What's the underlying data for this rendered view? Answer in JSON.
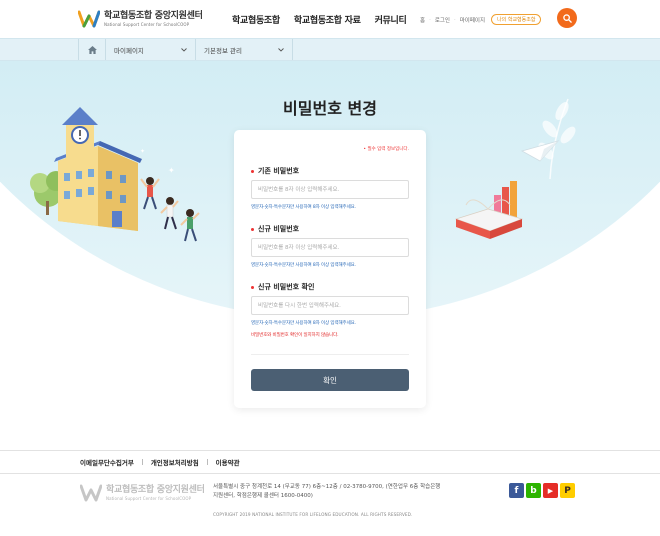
{
  "header": {
    "logo_title": "학교협동조합 중앙지원센터",
    "logo_subtitle": "National Support Center for SchoolCOOP",
    "nav": [
      "학교협동조합",
      "학교협동조합 자료",
      "커뮤니티"
    ],
    "util_home": "홈",
    "util_login": "로그인",
    "util_mypage": "마이페이지",
    "util_button": "나의 학교협동조합"
  },
  "breadcrumb": {
    "level1": "마이페이지",
    "level2": "기본정보 관리"
  },
  "page": {
    "title": "비밀번호 변경"
  },
  "form": {
    "required_note": "• 필수 입력 정보입니다.",
    "current": {
      "label": "기존 비밀번호",
      "placeholder": "비밀번호를 8자 이상 입력해주세요.",
      "hint": "영문자·숫자·특수문자만 사용하여 8자 이상 입력해주세요."
    },
    "new": {
      "label": "신규 비밀번호",
      "placeholder": "비밀번호를 8자 이상 입력해주세요.",
      "hint": "영문자·숫자·특수문자만 사용하여 8자 이상 입력해주세요."
    },
    "confirm": {
      "label": "신규 비밀번호 확인",
      "placeholder": "비밀번호를 다시 한번 입력해주세요.",
      "hint": "영문자·숫자·특수문자만 사용하여 8자 이상 입력해주세요.",
      "error": "비밀번호와 비밀번호 확인이 일치하지 않습니다."
    },
    "submit_label": "확인"
  },
  "footer": {
    "links": [
      "이메일무단수집거부",
      "개인정보처리방침",
      "이용약관"
    ],
    "address": "서울특별시 중구 청계천로 14 (무교동 77) 6층~12층 / 02-3780-9700, (연한업무 6층 학습은행지원센터, 학점은행제 콜센터 1600-0400)",
    "copyright": "COPYRIGHT 2019 NATIONAL INSTITUTE FOR LIFELONG EDUCATION. ALL RIGHTS RESERVED.",
    "sns": [
      {
        "name": "facebook",
        "glyph": "f",
        "color": "#3b5998"
      },
      {
        "name": "blog",
        "glyph": "b",
        "color": "#2db400"
      },
      {
        "name": "youtube",
        "glyph": "▶",
        "color": "#e52d27"
      },
      {
        "name": "kakao",
        "glyph": "P",
        "color": "#ffcd00"
      }
    ]
  },
  "colors": {
    "accent": "#f26a1b",
    "submit": "#4b5f73",
    "hint_blue": "#2a6ab8",
    "error_red": "#e02020"
  }
}
